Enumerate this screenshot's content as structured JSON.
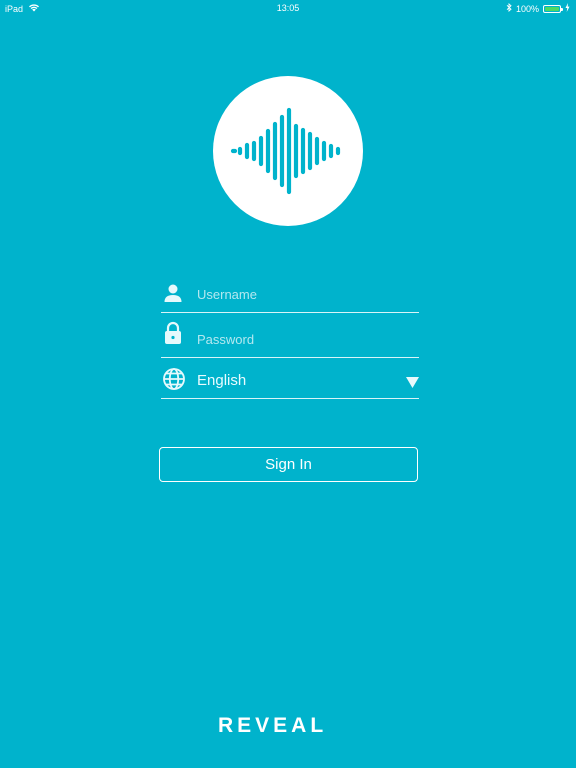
{
  "status_bar": {
    "device": "iPad",
    "time": "13:05",
    "battery": "100%",
    "battery_level": 1.0,
    "icons": [
      "wifi-icon",
      "bluetooth-icon",
      "battery-icon",
      "charging-icon"
    ]
  },
  "logo": {
    "icon": "sound-wave-icon"
  },
  "form": {
    "username_placeholder": "Username",
    "password_placeholder": "Password",
    "language_value": "English",
    "username_icon": "user-icon",
    "password_icon": "lock-icon",
    "language_icon": "globe-icon",
    "dropdown_icon": "caret-down-icon"
  },
  "signin_label": "Sign In",
  "brand": {
    "name": "REVEAL",
    "tagline": ""
  },
  "colors": {
    "background": "#00b3cc",
    "foreground": "#ffffff",
    "battery_fill": "#4cd964"
  }
}
